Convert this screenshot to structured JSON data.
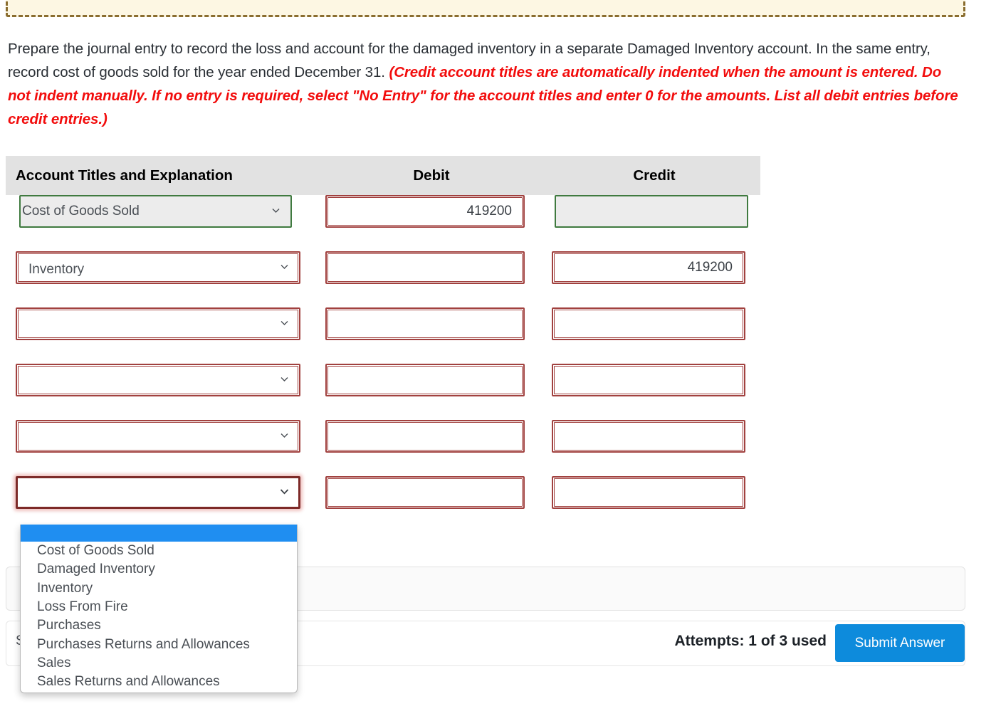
{
  "banner": {
    "text": ""
  },
  "prompt": {
    "plain_1": "Prepare the journal entry to record the loss and account for the damaged inventory in a separate Damaged Inventory account. In the same entry, record cost of goods sold for the year ended December 31. ",
    "hint": "(Credit account titles are automatically indented when the amount is entered. Do not indent manually. If no entry is required, select \"No Entry\" for the account titles and enter 0 for the amounts. List all debit entries before credit entries.)"
  },
  "table": {
    "headers": {
      "account": "Account Titles and Explanation",
      "debit": "Debit",
      "credit": "Credit"
    },
    "rows": [
      {
        "account": "Cost of Goods Sold",
        "debit": "419200",
        "credit": "",
        "state": "correct"
      },
      {
        "account": "Inventory",
        "debit": "",
        "credit": "419200",
        "state": "error"
      },
      {
        "account": "",
        "debit": "",
        "credit": "",
        "state": "error"
      },
      {
        "account": "",
        "debit": "",
        "credit": "",
        "state": "error"
      },
      {
        "account": "",
        "debit": "",
        "credit": "",
        "state": "error"
      },
      {
        "account": "",
        "debit": "",
        "credit": "",
        "state": "error-focused"
      }
    ]
  },
  "dropdown": {
    "open_for_row": 6,
    "selected_index": 0,
    "options": [
      "",
      "Cost of Goods Sold",
      "Damaged Inventory",
      "Inventory",
      "Loss From Fire",
      "Purchases",
      "Purchases Returns and Allowances",
      "Sales",
      "Sales Returns and Allowances"
    ]
  },
  "footer": {
    "save_for_later": "Save for Later",
    "attempts": "Attempts: 1 of 3 used",
    "submit_label": "Submit Answer"
  },
  "colors": {
    "error_border": "#a1413f",
    "error_border_focused": "#7d2a28",
    "correct_border": "#3f7a3f",
    "hint_red": "#f20d0d",
    "submit_blue": "#0d8bdc",
    "dropdown_highlight": "#1f8ef1",
    "banner_bg": "#fdf7e3",
    "banner_border": "#8a6d2f",
    "header_bg": "#e2e2e2"
  }
}
